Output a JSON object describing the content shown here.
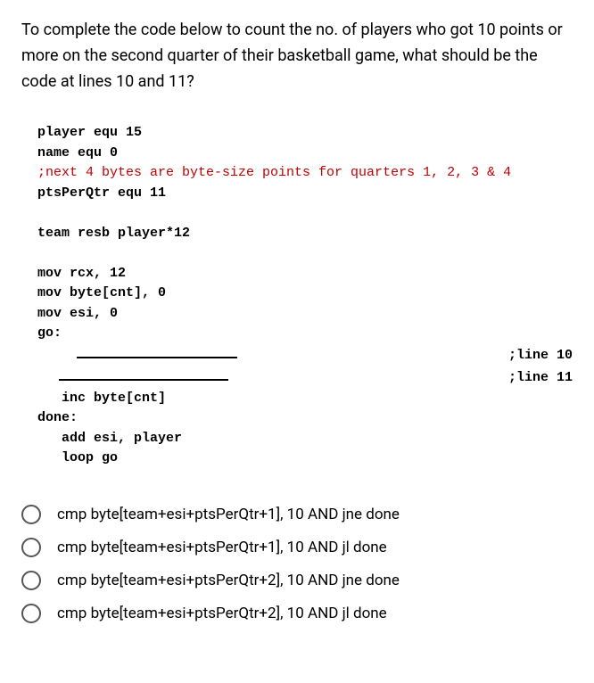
{
  "question": "To complete the code below to count the no. of players who got 10 points or more on the second quarter of their basketball game, what should be the code at lines 10 and 11?",
  "code": {
    "l1": "player equ 15",
    "l2": "name equ 0",
    "l3_comment": ";next 4 bytes are byte-size points for quarters 1, 2, 3 & 4",
    "l4": "ptsPerQtr equ 11",
    "l5": "team resb player*12",
    "l6": "mov rcx, 12",
    "l7": "mov byte[cnt], 0",
    "l8": "mov esi, 0",
    "l9": "go:",
    "line10_label": ";line 10",
    "line11_label": ";line 11",
    "l12": "   inc byte[cnt]",
    "l13": "done:",
    "l14": "   add esi, player",
    "l15": "   loop go"
  },
  "options": [
    "cmp byte[team+esi+ptsPerQtr+1], 10 AND jne done",
    "cmp byte[team+esi+ptsPerQtr+1], 10 AND jl done",
    "cmp byte[team+esi+ptsPerQtr+2], 10 AND jne done",
    "cmp byte[team+esi+ptsPerQtr+2], 10 AND jl done"
  ]
}
